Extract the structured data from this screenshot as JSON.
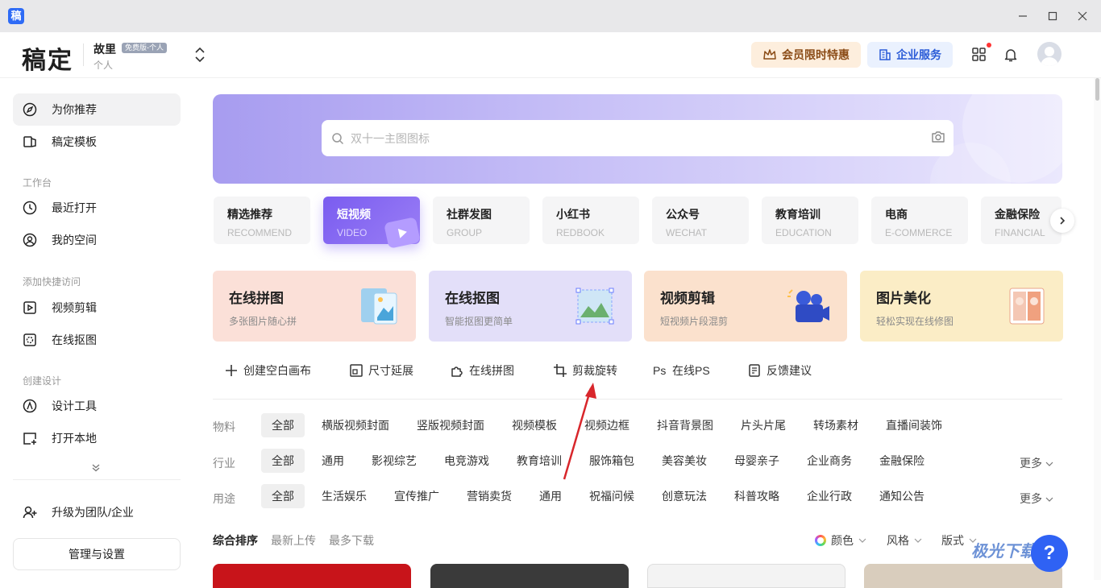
{
  "window": {
    "app_icon": "稿",
    "minimize_icon": "minimize-icon",
    "maximize_icon": "maximize-icon",
    "close_icon": "close-icon"
  },
  "header": {
    "brand": "稿定",
    "user_name": "故里",
    "user_badge": "免费版-个人",
    "user_type": "个人",
    "vip_button": "会员限时特惠",
    "enterprise_button": "企业服务"
  },
  "sidebar": {
    "items": [
      {
        "label": "为你推荐",
        "icon": "compass-icon"
      },
      {
        "label": "稿定模板",
        "icon": "template-icon"
      }
    ],
    "workspace_title": "工作台",
    "workspace_items": [
      {
        "label": "最近打开",
        "icon": "clock-icon"
      },
      {
        "label": "我的空间",
        "icon": "user-circle-icon"
      }
    ],
    "quick_title": "添加快捷访问",
    "quick_items": [
      {
        "label": "视频剪辑",
        "icon": "play-square-icon"
      },
      {
        "label": "在线抠图",
        "icon": "cutout-icon"
      }
    ],
    "create_title": "创建设计",
    "create_items": [
      {
        "label": "设计工具",
        "icon": "pen-tool-icon"
      },
      {
        "label": "打开本地",
        "icon": "folder-plus-icon"
      }
    ],
    "upgrade": "升级为团队/企业",
    "manage": "管理与设置"
  },
  "search": {
    "placeholder": "双十一主图图标"
  },
  "categories": [
    {
      "zh": "精选推荐",
      "en": "RECOMMEND"
    },
    {
      "zh": "短视频",
      "en": "VIDEO"
    },
    {
      "zh": "社群发图",
      "en": "GROUP"
    },
    {
      "zh": "小红书",
      "en": "REDBOOK"
    },
    {
      "zh": "公众号",
      "en": "WECHAT"
    },
    {
      "zh": "教育培训",
      "en": "EDUCATION"
    },
    {
      "zh": "电商",
      "en": "E-COMMERCE"
    },
    {
      "zh": "金融保险",
      "en": "FINANCIAL"
    }
  ],
  "features": [
    {
      "title": "在线拼图",
      "subtitle": "多张图片随心拼",
      "bg": "#fbe0d8"
    },
    {
      "title": "在线抠图",
      "subtitle": "智能抠图更简单",
      "bg": "#e3dff9"
    },
    {
      "title": "视频剪辑",
      "subtitle": "短视频片段混剪",
      "bg": "#fbe1cd"
    },
    {
      "title": "图片美化",
      "subtitle": "轻松实现在线修图",
      "bg": "#fbedc6"
    }
  ],
  "tools": [
    "创建空白画布",
    "尺寸延展",
    "在线拼图",
    "剪裁旋转",
    "在线PS",
    "反馈建议"
  ],
  "filters": {
    "material": {
      "label": "物料",
      "chips": [
        "全部",
        "横版视频封面",
        "竖版视频封面",
        "视频模板",
        "视频边框",
        "抖音背景图",
        "片头片尾",
        "转场素材",
        "直播间装饰"
      ]
    },
    "industry": {
      "label": "行业",
      "chips": [
        "全部",
        "通用",
        "影视综艺",
        "电竞游戏",
        "教育培训",
        "服饰箱包",
        "美容美妆",
        "母婴亲子",
        "企业商务",
        "金融保险"
      ],
      "more": "更多"
    },
    "usage": {
      "label": "用途",
      "chips": [
        "全部",
        "生活娱乐",
        "宣传推广",
        "营销卖货",
        "通用",
        "祝福问候",
        "创意玩法",
        "科普攻略",
        "企业行政",
        "通知公告"
      ],
      "more": "更多"
    }
  },
  "sort": {
    "options": [
      "综合排序",
      "最新上传",
      "最多下载"
    ],
    "color": "颜色",
    "style": "风格",
    "layout": "版式"
  },
  "thumb_colors": [
    "#c8141a",
    "#3a3a3a",
    "#f3f3f3",
    "#d9cdbd"
  ],
  "help": "?",
  "watermark": "极光下载站"
}
